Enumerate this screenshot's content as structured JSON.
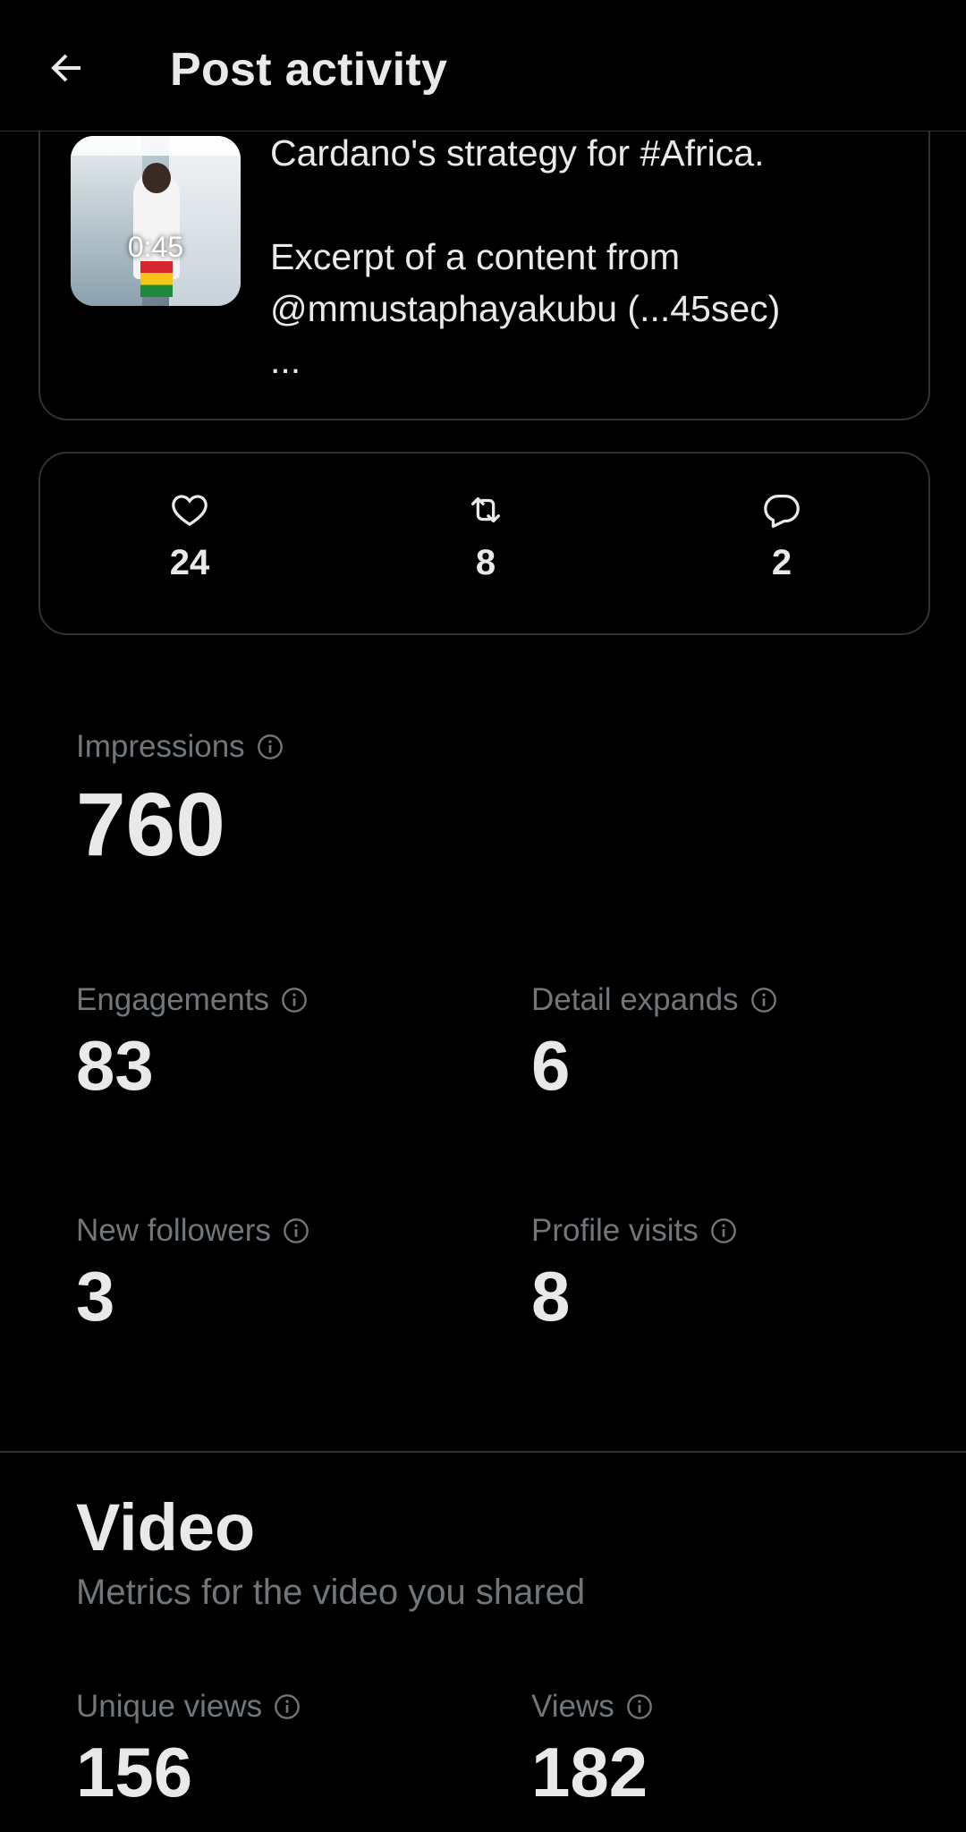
{
  "header": {
    "title": "Post activity",
    "back_icon": "arrow-left-icon"
  },
  "post": {
    "video_duration": "0:45",
    "text": "Cardano's strategy for #Africa.\n\nExcerpt of a content from\n@mmustaphayakubu (...45sec)\n..."
  },
  "engagement_bar": {
    "likes": {
      "icon": "heart-icon",
      "count": "24"
    },
    "reposts": {
      "icon": "repost-icon",
      "count": "8"
    },
    "replies": {
      "icon": "reply-icon",
      "count": "2"
    }
  },
  "metrics": {
    "impressions": {
      "label": "Impressions",
      "value": "760"
    },
    "engagements": {
      "label": "Engagements",
      "value": "83"
    },
    "detail_expands": {
      "label": "Detail expands",
      "value": "6"
    },
    "new_followers": {
      "label": "New followers",
      "value": "3"
    },
    "profile_visits": {
      "label": "Profile visits",
      "value": "8"
    }
  },
  "video_section": {
    "title": "Video",
    "subtitle": "Metrics for the video you shared",
    "unique_views": {
      "label": "Unique views",
      "value": "156"
    },
    "views": {
      "label": "Views",
      "value": "182"
    }
  },
  "colors": {
    "background": "#000000",
    "primary_text": "#e7e9ea",
    "secondary_text": "#71767b",
    "border": "#2f3336"
  }
}
